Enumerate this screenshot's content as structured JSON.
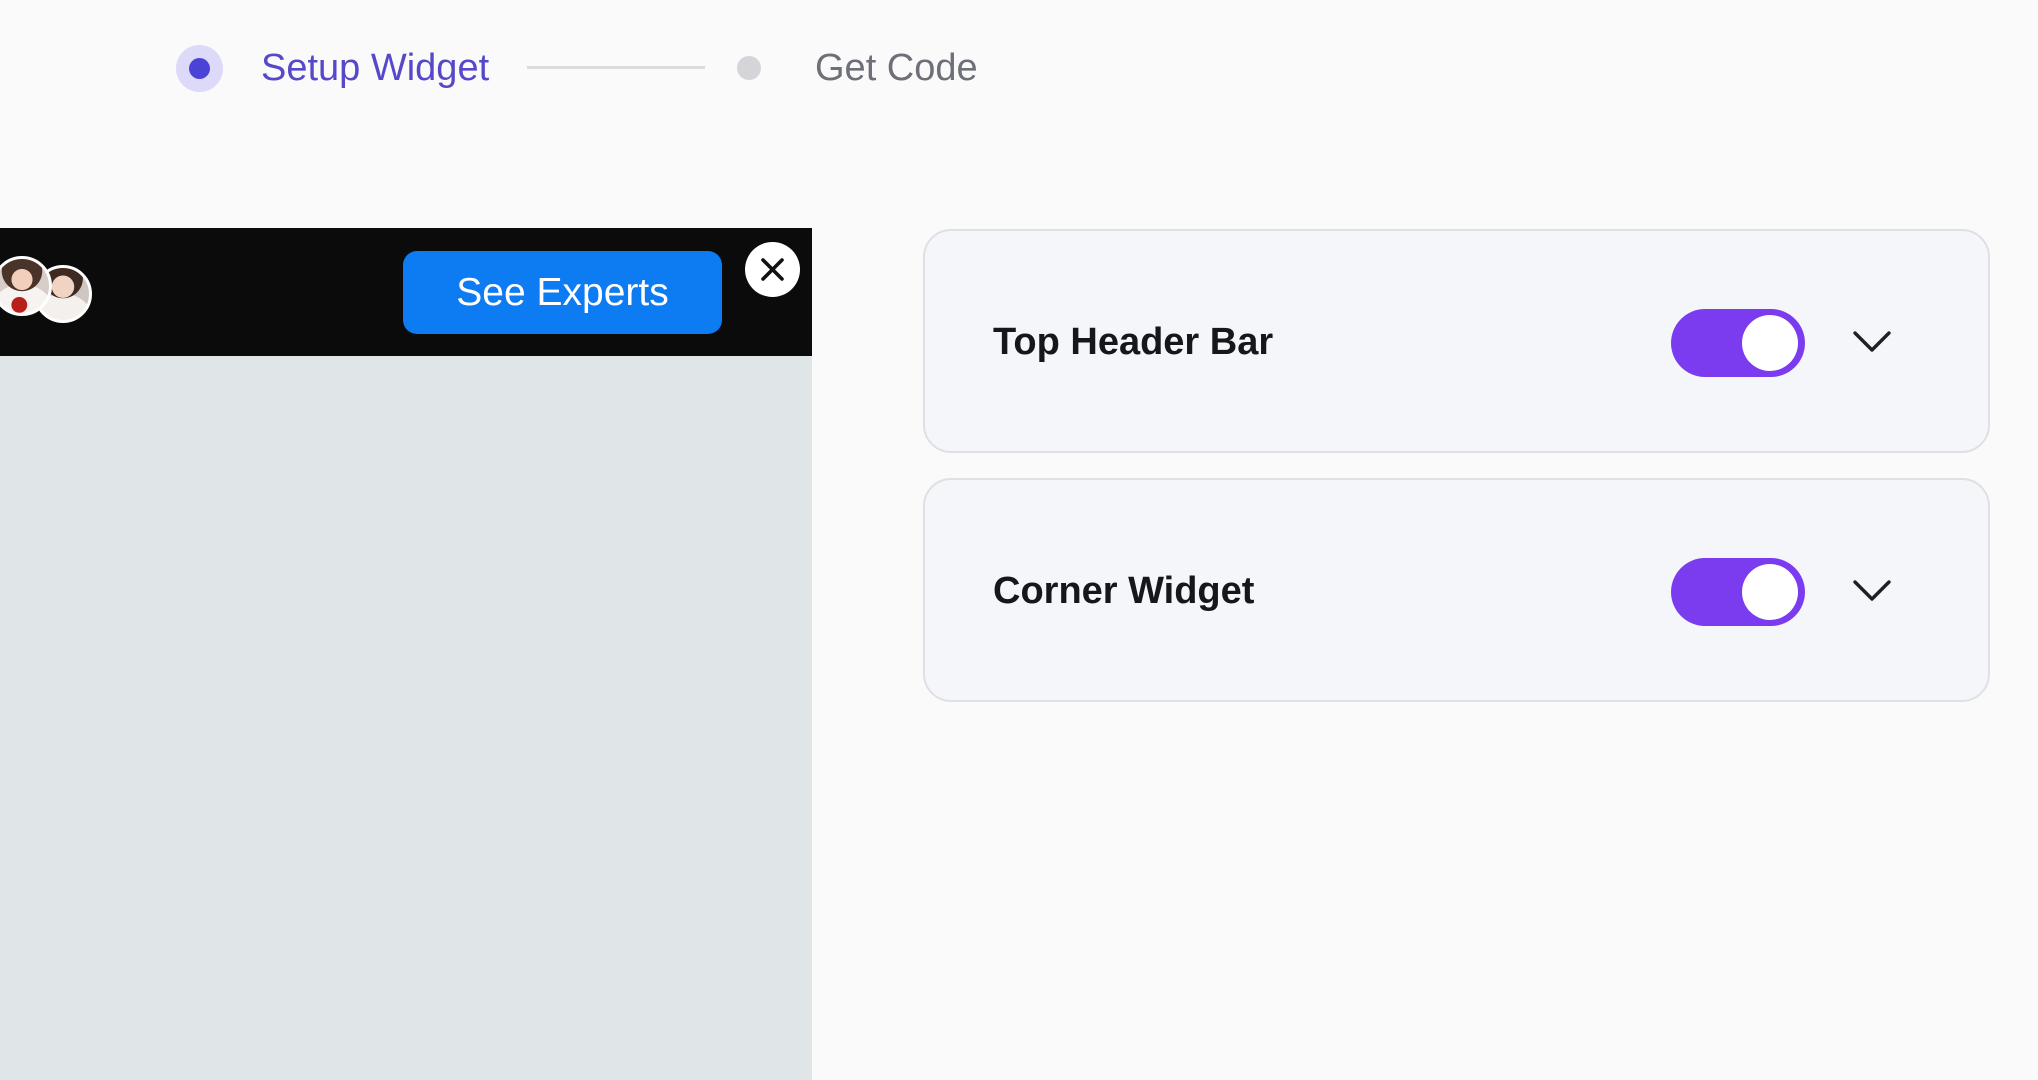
{
  "stepper": {
    "steps": [
      {
        "label": "Setup Widget",
        "state": "active"
      },
      {
        "label": "Get Code",
        "state": "inactive"
      }
    ]
  },
  "preview": {
    "cta_label": "See Experts",
    "close_icon": "close-icon",
    "avatars": [
      "avatar-woman-1",
      "avatar-woman-2"
    ]
  },
  "settings": {
    "cards": [
      {
        "title": "Top Header Bar",
        "enabled": true,
        "icon": "chevron-down-icon"
      },
      {
        "title": "Corner Widget",
        "enabled": true,
        "icon": "chevron-down-icon"
      }
    ]
  },
  "colors": {
    "accent": "#7b3cef",
    "stepper_active": "#5649c9",
    "cta_blue": "#0d7bf2",
    "bar_black": "#0b0b0b"
  }
}
